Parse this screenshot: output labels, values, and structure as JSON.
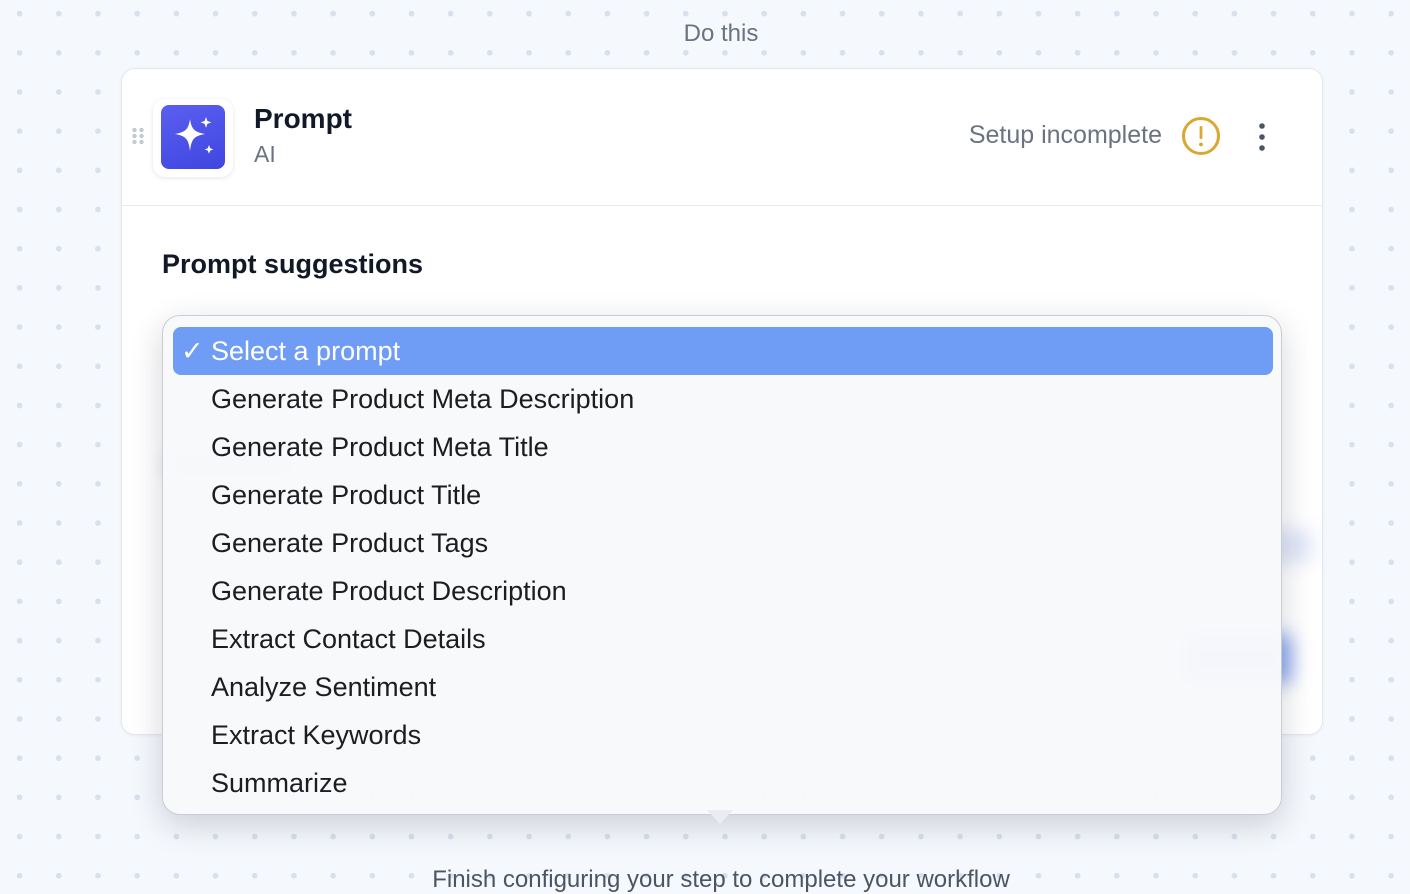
{
  "workflow": {
    "step_label": "Do this",
    "footer_note": "Finish configuring your step to complete your workflow"
  },
  "step": {
    "title": "Prompt",
    "subtitle": "AI",
    "status": "Setup incomplete",
    "icon": "sparkles-icon",
    "accent_color": "#4a4fe8",
    "warning_color": "#d9a830"
  },
  "prompt_suggestions": {
    "label": "Prompt suggestions",
    "selected_index": 0,
    "highlight_color": "#6f9cf4",
    "options": [
      "Select a prompt",
      "Generate Product Meta Description",
      "Generate Product Meta Title",
      "Generate Product Title",
      "Generate Product Tags",
      "Generate Product Description",
      "Extract Contact Details",
      "Analyze Sentiment",
      "Extract Keywords",
      "Summarize"
    ]
  }
}
